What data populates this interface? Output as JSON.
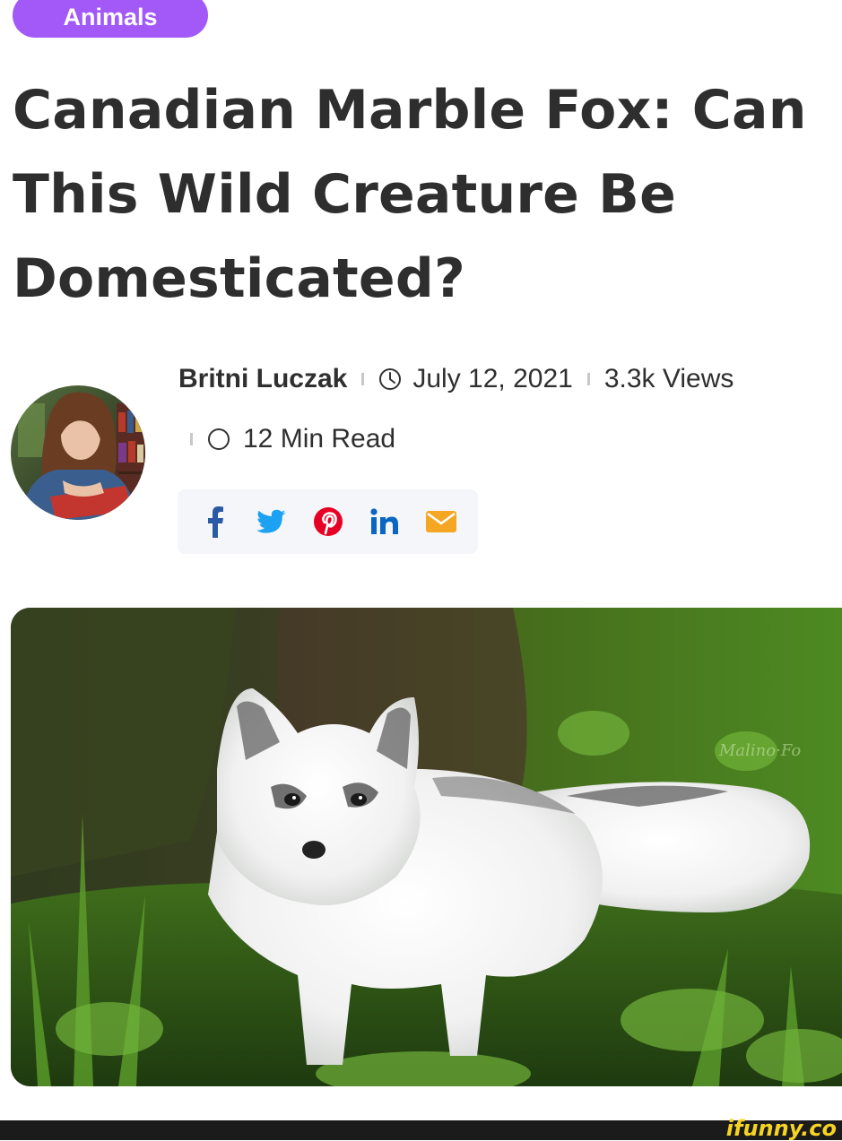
{
  "category": {
    "label": "Animals",
    "color": "#a259f7"
  },
  "article": {
    "title": "Canadian Marble Fox: Can This Wild Creature Be Domesticated?"
  },
  "meta": {
    "author": "Britni Luczak",
    "date": "July 12, 2021",
    "views": "3.3k Views",
    "read_time": "12 Min Read",
    "date_icon": "clock-icon",
    "read_icon": "circle-icon"
  },
  "share": {
    "buttons": [
      {
        "icon": "facebook-icon",
        "color": "#2a5aa5"
      },
      {
        "icon": "twitter-icon",
        "color": "#1da1f2"
      },
      {
        "icon": "pinterest-icon",
        "color": "#e60023"
      },
      {
        "icon": "linkedin-icon",
        "color": "#0a66c2"
      },
      {
        "icon": "email-icon",
        "color": "#f5a623"
      }
    ]
  },
  "hero_image": {
    "subject": "marble-fox-photo"
  },
  "watermark": {
    "text": "ifunny.co"
  }
}
